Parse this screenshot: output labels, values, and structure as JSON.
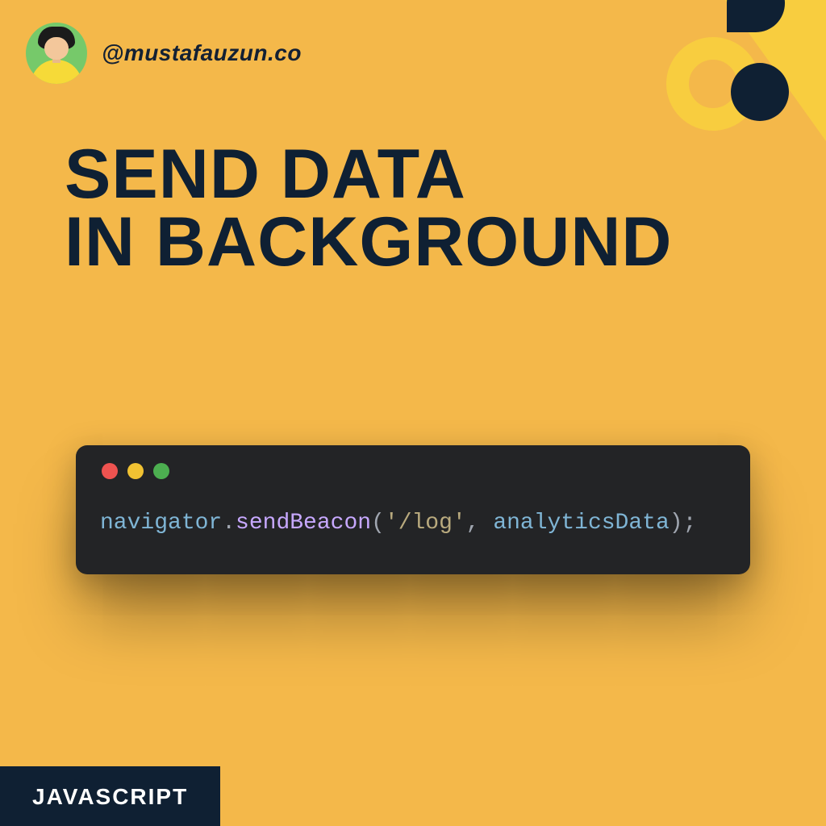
{
  "colors": {
    "bg": "#f4b84a",
    "ink": "#0f2033",
    "code_bg": "#232426",
    "accent_yellow": "#f8cd3f",
    "accent_dark": "#0f2033"
  },
  "header": {
    "handle": "@mustafauzun.co"
  },
  "title": {
    "line1": "SEND DATA",
    "line2": "IN BACKGROUND"
  },
  "code": {
    "tokens": {
      "obj": "navigator",
      "dot": ".",
      "method": "sendBeacon",
      "open": "(",
      "str": "'/log'",
      "comma": ", ",
      "arg": "analyticsData",
      "close": ");"
    }
  },
  "footer": {
    "tag": "JAVASCRIPT"
  },
  "icons": {
    "avatar": "avatar-icon",
    "traffic_red": "window-close-icon",
    "traffic_yellow": "window-minimize-icon",
    "traffic_green": "window-maximize-icon"
  }
}
